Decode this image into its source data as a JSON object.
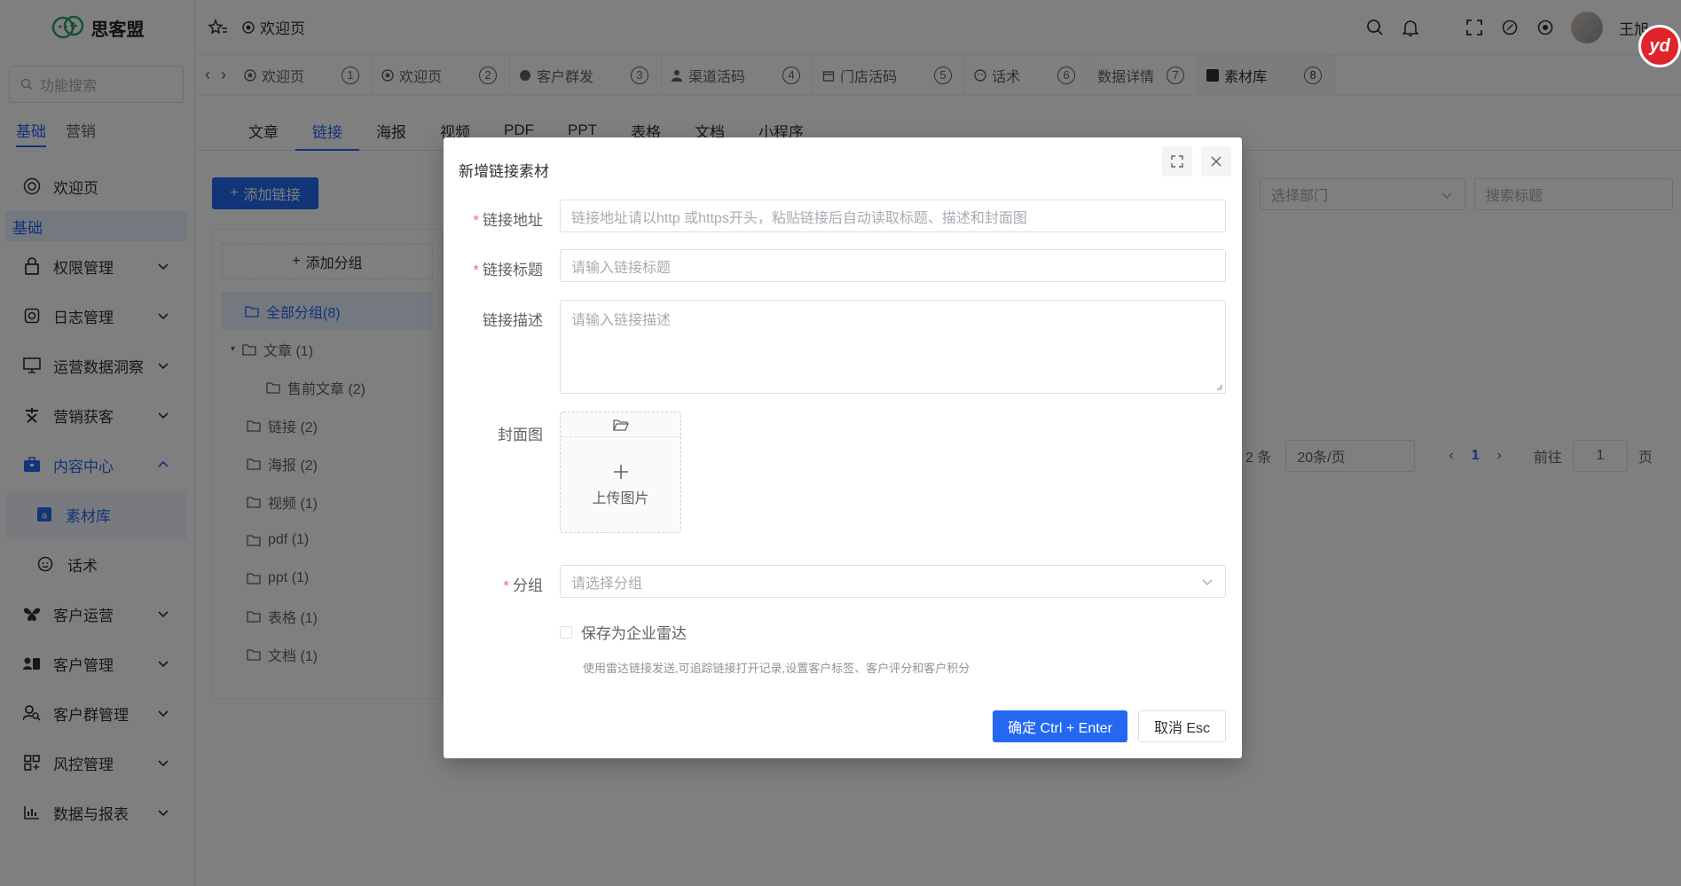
{
  "app": {
    "name": "思客盟"
  },
  "sidebar": {
    "search_placeholder": "功能搜索",
    "mode_tabs": [
      "基础",
      "营销"
    ],
    "welcome": "欢迎页",
    "group_head": "基础",
    "items": [
      "权限管理",
      "日志管理",
      "运营数据洞察",
      "营销获客",
      "内容中心"
    ],
    "sub_items": [
      "素材库",
      "话术"
    ],
    "items2": [
      "客户运营",
      "客户管理",
      "客户群管理",
      "风控管理",
      "数据与报表"
    ]
  },
  "header": {
    "fav_label": "欢迎页",
    "user": "王旭"
  },
  "tags": [
    {
      "label": "欢迎页",
      "num": "①"
    },
    {
      "label": "欢迎页",
      "num": "②"
    },
    {
      "label": "客户群发",
      "num": "③"
    },
    {
      "label": "渠道活码",
      "num": "④"
    },
    {
      "label": "门店活码",
      "num": "⑤"
    },
    {
      "label": "话术",
      "num": "⑥"
    },
    {
      "label": "数据详情",
      "num": "⑦"
    },
    {
      "label": "素材库",
      "num": "⑧"
    }
  ],
  "content_tabs": [
    "文章",
    "链接",
    "海报",
    "视频",
    "PDF",
    "PPT",
    "表格",
    "文档",
    "小程序"
  ],
  "toolbar": {
    "add_link": "添加链接",
    "dept_placeholder": "选择部门",
    "search_placeholder": "搜索标题"
  },
  "tree": {
    "add_group": "添加分组",
    "nodes": [
      "全部分组(8)",
      "文章 (1)",
      "售前文章 (2)",
      "链接 (2)",
      "海报 (2)",
      "视频 (1)",
      "pdf (1)",
      "ppt (1)",
      "表格 (1)",
      "文档 (1)"
    ]
  },
  "pager": {
    "total": "2 条",
    "size": "20条/页",
    "current": "1",
    "goto": "前往",
    "goto_value": "1",
    "page_unit": "页"
  },
  "dialog": {
    "title": "新增链接素材",
    "url_label": "链接地址",
    "url_placeholder": "链接地址请以http 或https开头，粘贴链接后自动读取标题、描述和封面图",
    "title_label": "链接标题",
    "title_placeholder": "请输入链接标题",
    "desc_label": "链接描述",
    "desc_placeholder": "请输入链接描述",
    "cover_label": "封面图",
    "upload_text": "上传图片",
    "group_label": "分组",
    "group_placeholder": "请选择分组",
    "radar_label": "保存为企业雷达",
    "radar_hint": "使用雷达链接发送,可追踪链接打开记录,设置客户标签、客户评分和客户积分",
    "ok": "确定 Ctrl + Enter",
    "cancel": "取消 Esc"
  },
  "badge": "yd",
  "colors": {
    "primary": "#2468f2",
    "danger": "#f56c6c",
    "mask": "rgba(0,0,0,0.5)"
  }
}
